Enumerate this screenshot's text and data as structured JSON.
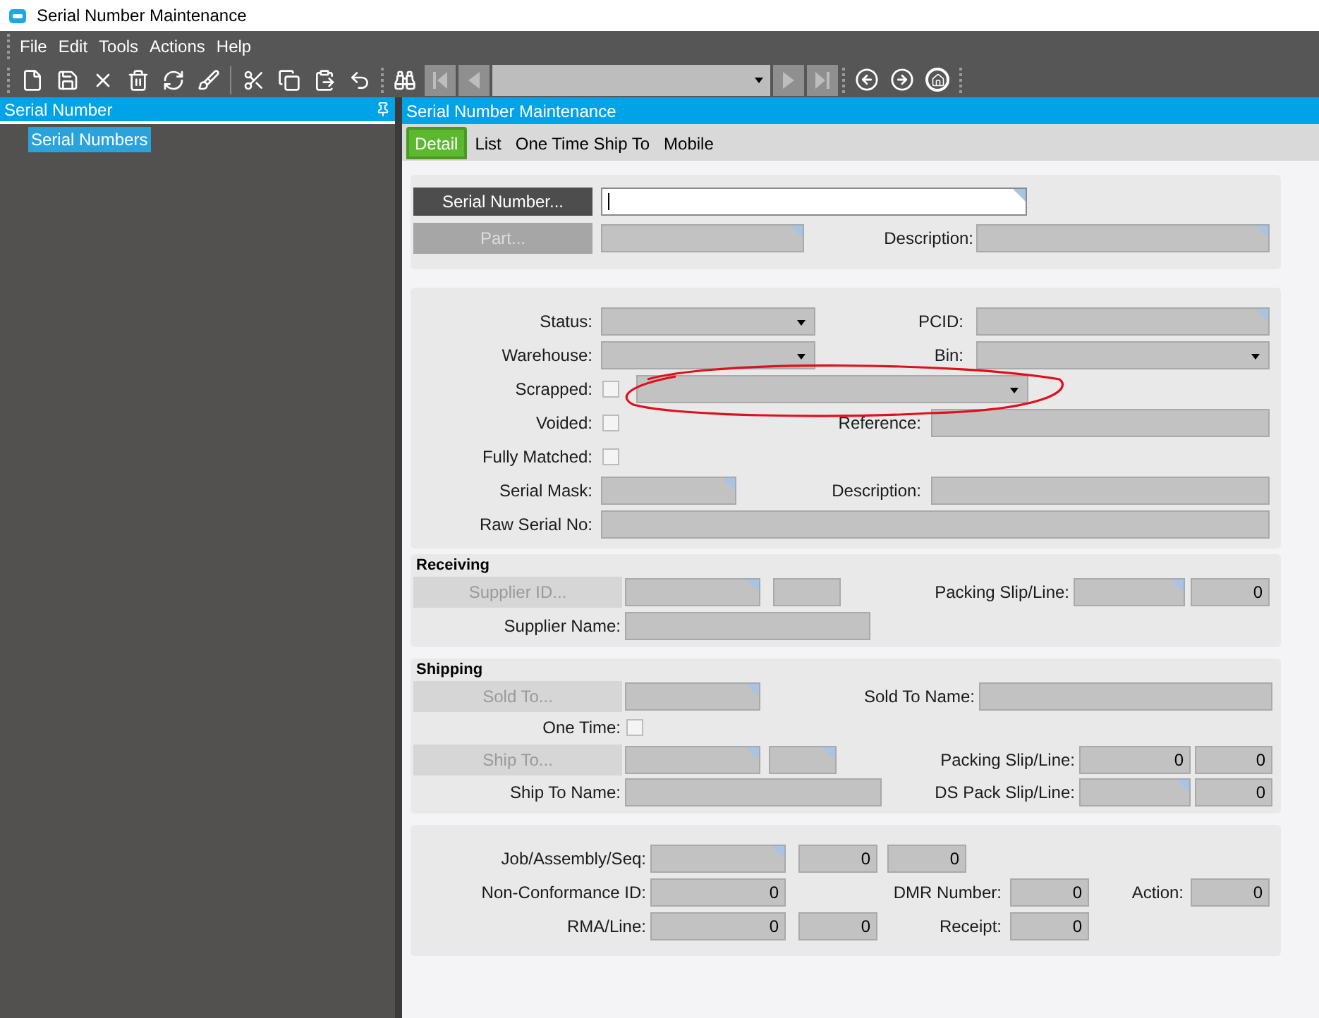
{
  "window": {
    "title": "Serial Number Maintenance"
  },
  "menu": [
    {
      "label": "File"
    },
    {
      "label": "Edit"
    },
    {
      "label": "Tools"
    },
    {
      "label": "Actions"
    },
    {
      "label": "Help"
    }
  ],
  "left_panel": {
    "title": "Serial Number",
    "tree": [
      {
        "label": "Serial Numbers",
        "selected": true
      }
    ]
  },
  "main_panel": {
    "title": "Serial Number Maintenance"
  },
  "tabs": [
    {
      "label": "Detail",
      "selected": true
    },
    {
      "label": "List",
      "selected": false
    },
    {
      "label": "One Time Ship To",
      "selected": false
    },
    {
      "label": "Mobile",
      "selected": false
    }
  ],
  "header": {
    "serial_number_button": {
      "label": "Serial Number...",
      "disabled": false
    },
    "part_button": {
      "label": "Part...",
      "disabled": true
    },
    "description_label": "Description:"
  },
  "details": {
    "status_label": "Status:",
    "pcid_label": "PCID:",
    "warehouse_label": "Warehouse:",
    "bin_label": "Bin:",
    "scrapped": {
      "label": "Scrapped:",
      "checked": false
    },
    "voided": {
      "label": "Voided:",
      "checked": false
    },
    "reference_label": "Reference:",
    "fully_matched": {
      "label": "Fully Matched:",
      "checked": false
    },
    "serial_mask_label": "Serial Mask:",
    "description_label": "Description:",
    "raw_serial_label": "Raw Serial No:"
  },
  "receiving": {
    "title": "Receiving",
    "supplier_button": {
      "label": "Supplier ID...",
      "disabled": true
    },
    "packing_slip_label": "Packing Slip/Line:",
    "packing_line": "0",
    "supplier_name_label": "Supplier Name:"
  },
  "shipping": {
    "title": "Shipping",
    "sold_to_button": {
      "label": "Sold To...",
      "disabled": true
    },
    "sold_to_name_label": "Sold To Name:",
    "one_time": {
      "label": "One Time:",
      "checked": false
    },
    "ship_to_button": {
      "label": "Ship To...",
      "disabled": true
    },
    "packing_slip_label": "Packing Slip/Line:",
    "packing_slip": "0",
    "packing_line": "0",
    "ship_to_name_label": "Ship To Name:",
    "ds_pack_label": "DS Pack Slip/Line:",
    "ds_pack_line": "0"
  },
  "references": {
    "job_label": "Job/Assembly/Seq:",
    "assembly": "0",
    "seq": "0",
    "ncr_label": "Non-Conformance ID:",
    "ncr": "0",
    "dmr_label": "DMR Number:",
    "dmr": "0",
    "action_label": "Action:",
    "action": "0",
    "rma_label": "RMA/Line:",
    "rma": "0",
    "rma_line": "0",
    "receipt_label": "Receipt:",
    "receipt": "0"
  }
}
